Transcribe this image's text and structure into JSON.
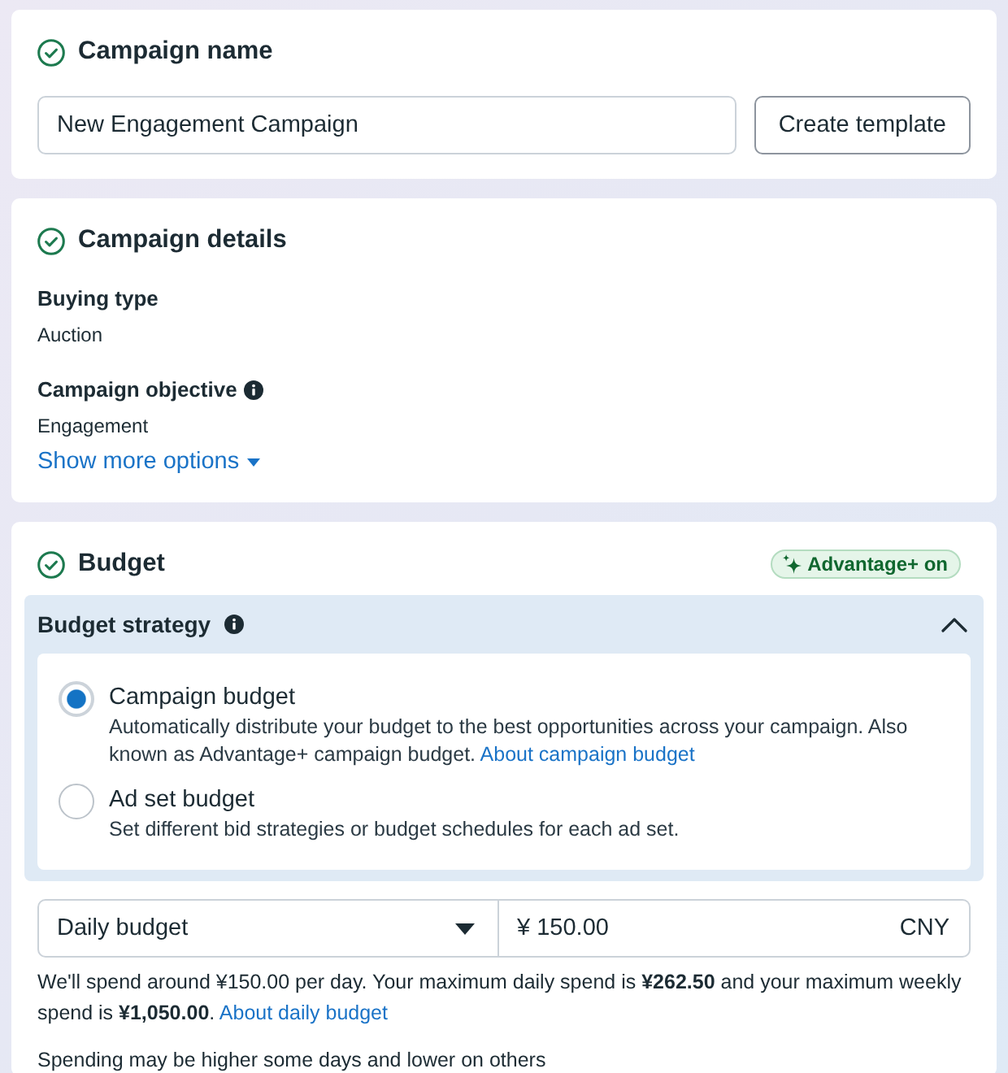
{
  "campaign_name": {
    "title": "Campaign name",
    "completed": true,
    "value": "New Engagement Campaign",
    "button": "Create template"
  },
  "campaign_details": {
    "title": "Campaign details",
    "completed": true,
    "fields": [
      {
        "label": "Buying type",
        "info": false,
        "value": "Auction"
      },
      {
        "label": "Campaign objective",
        "info": true,
        "value": "Engagement"
      }
    ],
    "link": "Show more options"
  },
  "budget": {
    "title": "Budget",
    "completed": true,
    "badge": "Advantage+ on",
    "strategy": {
      "title": "Budget strategy",
      "expanded": true,
      "options": [
        {
          "label": "Campaign budget",
          "description": "Automatically distribute your budget to the best opportunities across your campaign. Also known as Advantage+ campaign budget.",
          "link": "About campaign budget",
          "selected": true
        },
        {
          "label": "Ad set budget",
          "description": "Set different bid strategies or budget schedules for each ad set.",
          "selected": false
        }
      ]
    },
    "budget_type": "Daily budget",
    "amount": "¥ 150.00",
    "currency": "CNY",
    "note": "We'll spend around ¥150.00 per day. Your maximum daily spend is **¥262.50** and your maximum weekly spend is **¥1,050.00**.",
    "note_link": "About daily budget",
    "note_2": "Spending may be higher some days and lower on others"
  }
}
